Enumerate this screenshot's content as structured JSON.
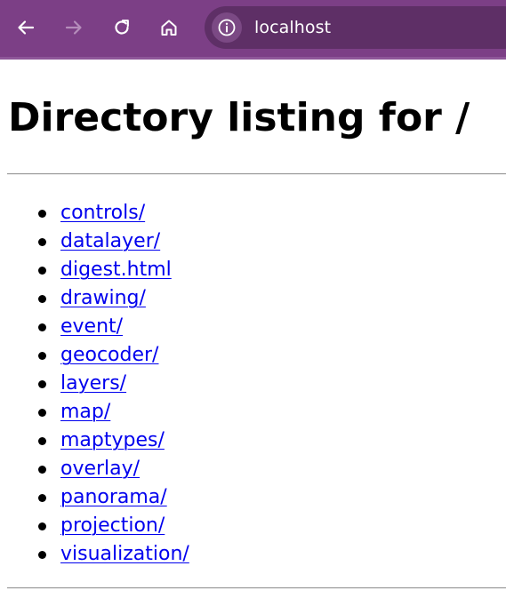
{
  "browser": {
    "address": "localhost",
    "icons": [
      "back-arrow-icon",
      "forward-arrow-icon",
      "reload-icon",
      "home-icon",
      "site-info-icon"
    ],
    "colors": {
      "toolbar": "#7c3f86",
      "omnibox": "#5e2f66",
      "forward_disabled": "#b58dbb"
    }
  },
  "page": {
    "title": "Directory listing for /",
    "items": [
      {
        "label": "controls/"
      },
      {
        "label": "datalayer/"
      },
      {
        "label": "digest.html"
      },
      {
        "label": "drawing/"
      },
      {
        "label": "event/"
      },
      {
        "label": "geocoder/"
      },
      {
        "label": "layers/"
      },
      {
        "label": "map/"
      },
      {
        "label": "maptypes/"
      },
      {
        "label": "overlay/"
      },
      {
        "label": "panorama/"
      },
      {
        "label": "projection/"
      },
      {
        "label": "visualization/"
      }
    ],
    "link_color": "#0000ee"
  }
}
